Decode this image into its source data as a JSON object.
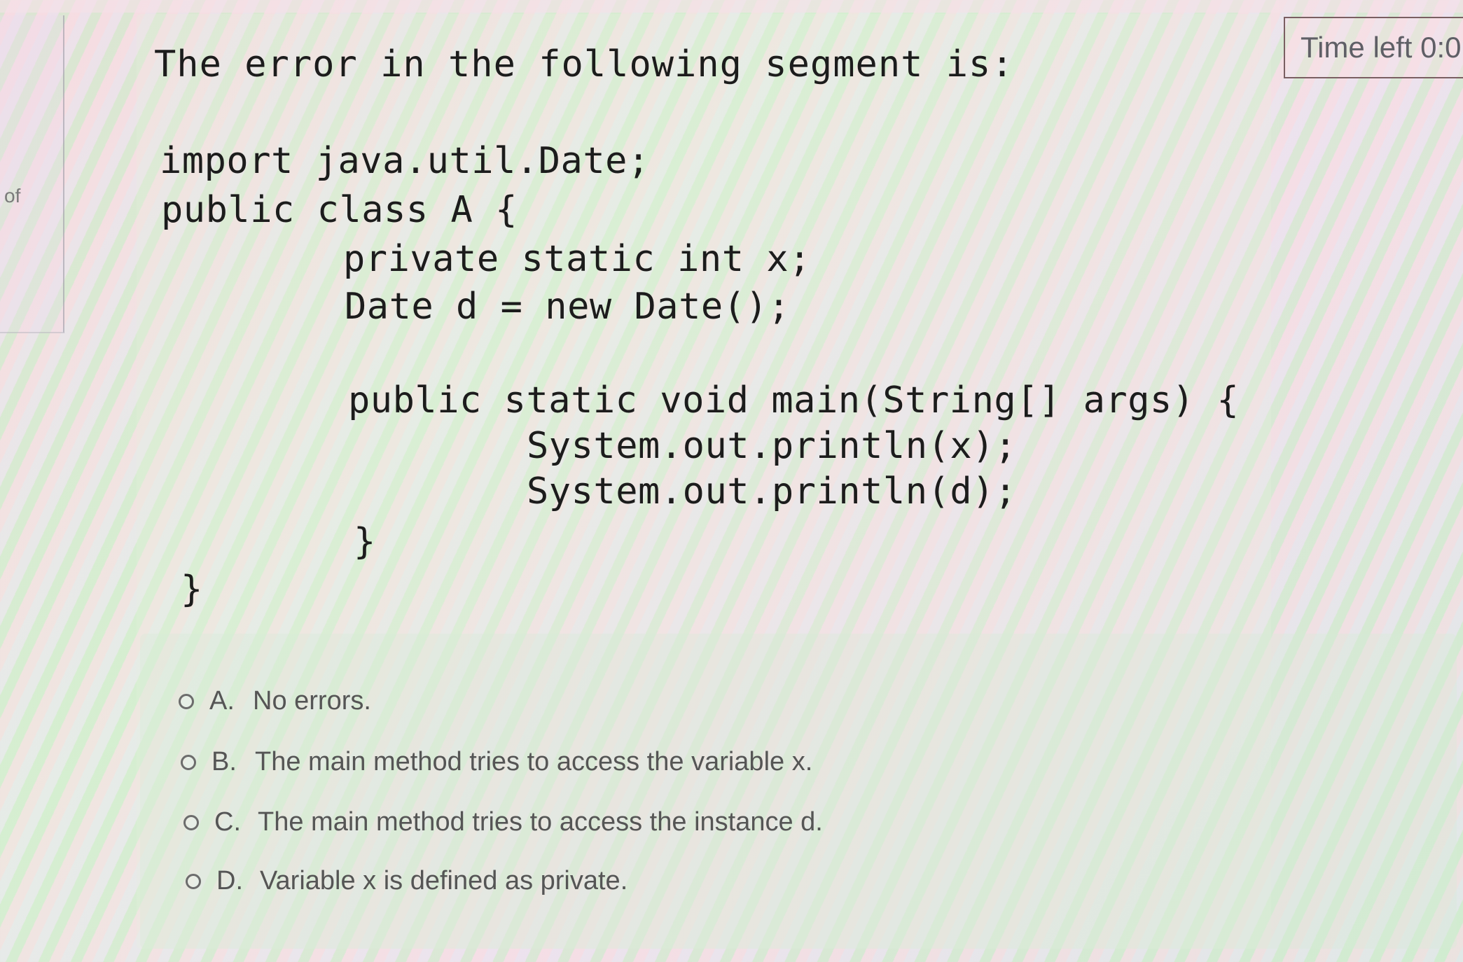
{
  "sidebar": {
    "page_of_label": "of"
  },
  "timer": {
    "label": "Time left 0:0"
  },
  "question": {
    "prompt": "The error in the following segment is:",
    "code_lines": [
      "import java.util.Date;",
      "public class A {",
      "private static int x;",
      "Date d = new Date();",
      "public static void main(String[] args) {",
      "System.out.println(x);",
      "System.out.println(d);",
      "}",
      "}"
    ]
  },
  "options": [
    {
      "letter": "A.",
      "text": "No errors.",
      "selected": false
    },
    {
      "letter": "B.",
      "text": "The main method tries to access the variable x.",
      "selected": false
    },
    {
      "letter": "C.",
      "text": "The main method tries to access the instance d.",
      "selected": false
    },
    {
      "letter": "D.",
      "text": "Variable x is defined as private.",
      "selected": false
    }
  ]
}
